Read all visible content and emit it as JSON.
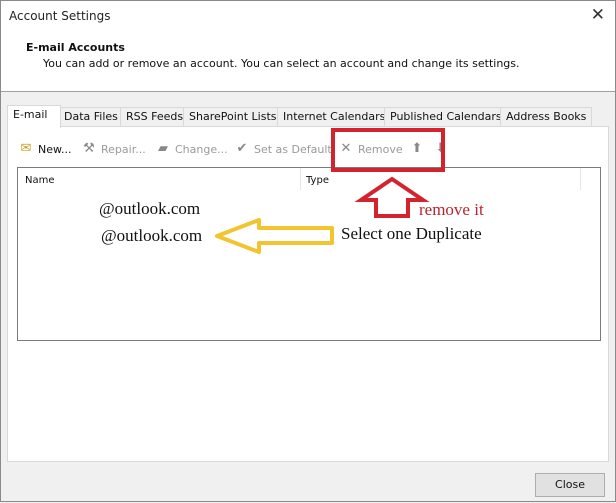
{
  "window": {
    "title": "Account Settings",
    "close_icon": "close-icon"
  },
  "header": {
    "title": "E-mail Accounts",
    "subtitle": "You can add or remove an account. You can select an account and change its settings."
  },
  "tabs": [
    {
      "label": "E-mail",
      "active": true
    },
    {
      "label": "Data Files",
      "active": false
    },
    {
      "label": "RSS Feeds",
      "active": false
    },
    {
      "label": "SharePoint Lists",
      "active": false
    },
    {
      "label": "Internet Calendars",
      "active": false
    },
    {
      "label": "Published Calendars",
      "active": false
    },
    {
      "label": "Address Books",
      "active": false
    }
  ],
  "toolbar": {
    "new_label": "New...",
    "repair_label": "Repair...",
    "change_label": "Change...",
    "set_default_label": "Set as Default",
    "remove_label": "Remove",
    "icons": {
      "new": "new-account-icon",
      "repair": "repair-tools-icon",
      "change": "change-icon",
      "set_default": "checkmark-circle-icon",
      "remove": "x-icon",
      "move_up": "arrow-up-icon",
      "move_down": "arrow-down-icon"
    }
  },
  "list": {
    "columns": [
      "Name",
      "Type"
    ],
    "rows": [
      {
        "name": "@outlook.com",
        "type": ""
      },
      {
        "name": "@outlook.com",
        "type": ""
      }
    ]
  },
  "annotations": {
    "remove_hint": "remove it",
    "select_hint": "Select one Duplicate",
    "colors": {
      "red": "#d3232f",
      "yellow": "#f2c530",
      "red_text": "#b8242c"
    }
  },
  "footer": {
    "close_label": "Close"
  }
}
